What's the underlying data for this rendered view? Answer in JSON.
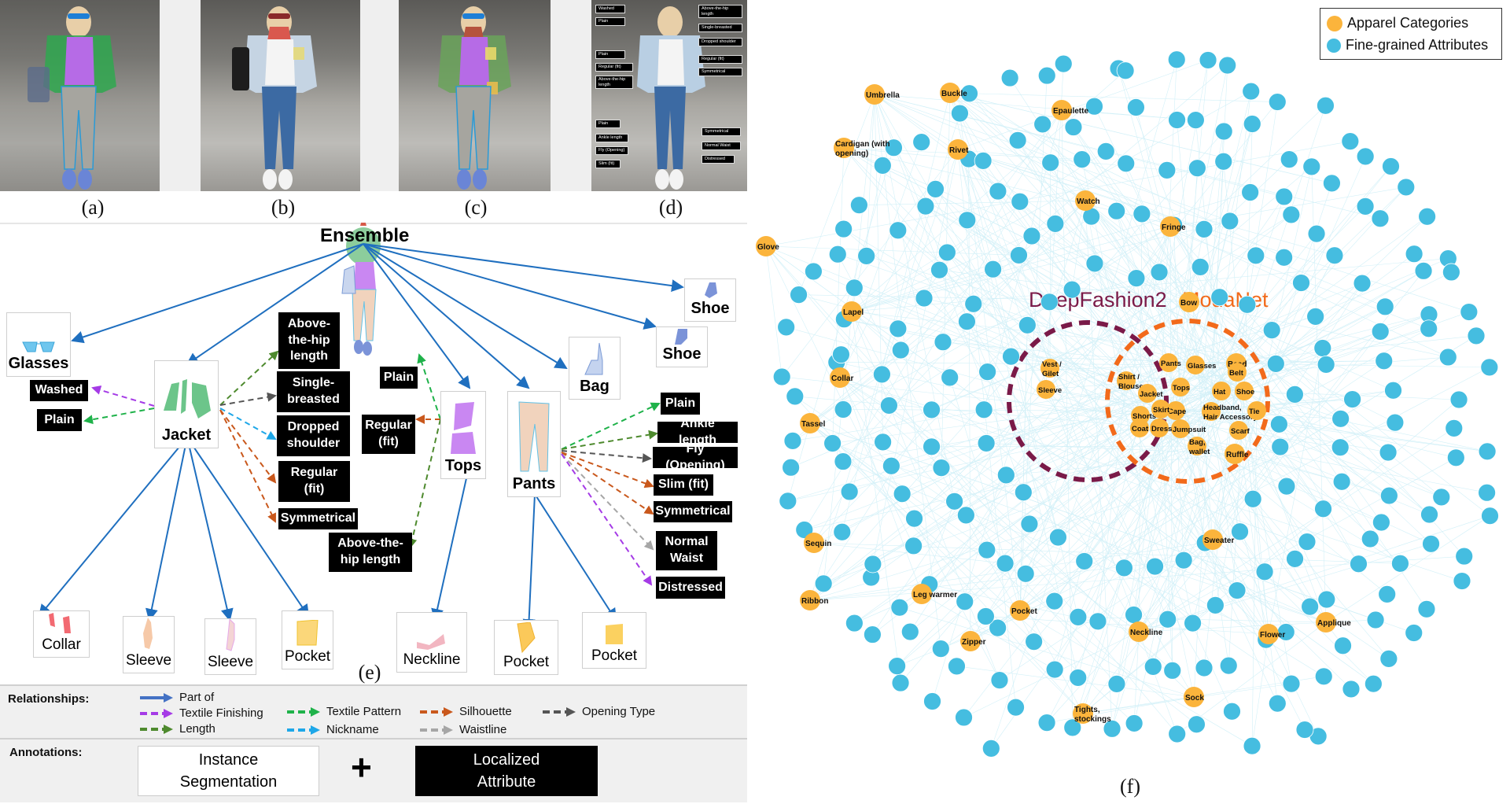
{
  "panels": {
    "captions": [
      "(a)",
      "(b)",
      "(c)",
      "(d)",
      "(e)",
      "(f)"
    ]
  },
  "photo_d_tags": {
    "left": [
      "Washed",
      "Plain",
      "Plain",
      "Regular (fit)",
      "Above-the-hip length",
      "Plain",
      "Ankle length",
      "Fly (Opening)",
      "Slim (fit)"
    ],
    "right": [
      "Above-the-hip length",
      "Single-breasted",
      "Dropped shoulder",
      "Regular (fit)",
      "Symmetrical",
      "Symmetrical",
      "Normal Waist",
      "Distressed"
    ]
  },
  "ontology": {
    "root": "Ensemble",
    "categories": {
      "glasses": "Glasses",
      "jacket": "Jacket",
      "tops": "Tops",
      "pants": "Pants",
      "bag": "Bag",
      "shoe1": "Shoe",
      "shoe2": "Shoe"
    },
    "jacket_attributes": {
      "washed": "Washed",
      "plain": "Plain",
      "length": "Above-the-hip length",
      "opening": "Single-breasted",
      "nickname": "Dropped shoulder",
      "silhouette_fit": "Regular (fit)",
      "silhouette_sym": "Symmetrical"
    },
    "tops_attributes": {
      "plain": "Plain",
      "fit": "Regular (fit)",
      "length": "Above-the-hip length"
    },
    "pants_attributes": {
      "plain": "Plain",
      "length": "Ankle length",
      "opening": "Fly (Opening)",
      "fit": "Slim (fit)",
      "sym": "Symmetrical",
      "waist": "Normal Waist",
      "finishing": "Distressed"
    },
    "parts": {
      "collar": "Collar",
      "sleeve1": "Sleeve",
      "sleeve2": "Sleeve",
      "jacket_pocket": "Pocket",
      "neckline": "Neckline",
      "pants_pocket1": "Pocket",
      "pants_pocket2": "Pocket"
    }
  },
  "legend": {
    "relationships_title": "Relationships:",
    "annotations_title": "Annotations:",
    "relationships": [
      {
        "label": "Part of",
        "color": "#4472c4",
        "style": "solid"
      },
      {
        "label": "Textile Finishing",
        "color": "#a53be6",
        "style": "dashed"
      },
      {
        "label": "Textile Pattern",
        "color": "#1fb24a",
        "style": "dashed"
      },
      {
        "label": "Silhouette",
        "color": "#c9581c",
        "style": "dashed"
      },
      {
        "label": "Opening Type",
        "color": "#555555",
        "style": "dashed"
      },
      {
        "label": "Length",
        "color": "#4e8a2e",
        "style": "dashed"
      },
      {
        "label": "Nickname",
        "color": "#1ea7e8",
        "style": "dashed"
      },
      {
        "label": "Waistline",
        "color": "#a6a6a6",
        "style": "dashed"
      }
    ],
    "annotation_instance": "Instance Segmentation",
    "annotation_plus": "+",
    "annotation_localized": "Localized Attribute"
  },
  "graph": {
    "legend": {
      "apparel": "Apparel Categories",
      "attributes": "Fine-grained Attributes",
      "apparel_color": "#fbb43c",
      "attribute_color": "#45bde0"
    },
    "datasets": {
      "deepfashion2": "DeepFashion2",
      "modanet": "ModaNet",
      "deepfashion2_color": "#7a1a48",
      "modanet_color": "#f26a1b"
    },
    "deepfashion2_only": [
      "Vest / Gilet",
      "Sleeve"
    ],
    "shared": [
      "Shirt / Blouse",
      "Pants",
      "Jacket",
      "Tops",
      "Cape",
      "Shorts",
      "Skirt",
      "Jumpsuit",
      "Coat",
      "Dress"
    ],
    "modanet_only": [
      "Glasses",
      "Belt",
      "Hat",
      "Shoe",
      "Headband, Hair Accessory",
      "Tie",
      "Scarf",
      "Bag, wallet"
    ],
    "outer_categories": [
      "Umbrella",
      "Buckle",
      "Epaulette",
      "Cardigan (with opening)",
      "Rivet",
      "Watch",
      "Fringe",
      "Glove",
      "Lapel",
      "Bow",
      "Collar",
      "Bead",
      "Tassel",
      "Ruffle",
      "Sequin",
      "Sweater",
      "Ribbon",
      "Leg warmer",
      "Pocket",
      "Applique",
      "Zipper",
      "Neckline",
      "Flower",
      "Sock",
      "Tights, stockings"
    ]
  }
}
